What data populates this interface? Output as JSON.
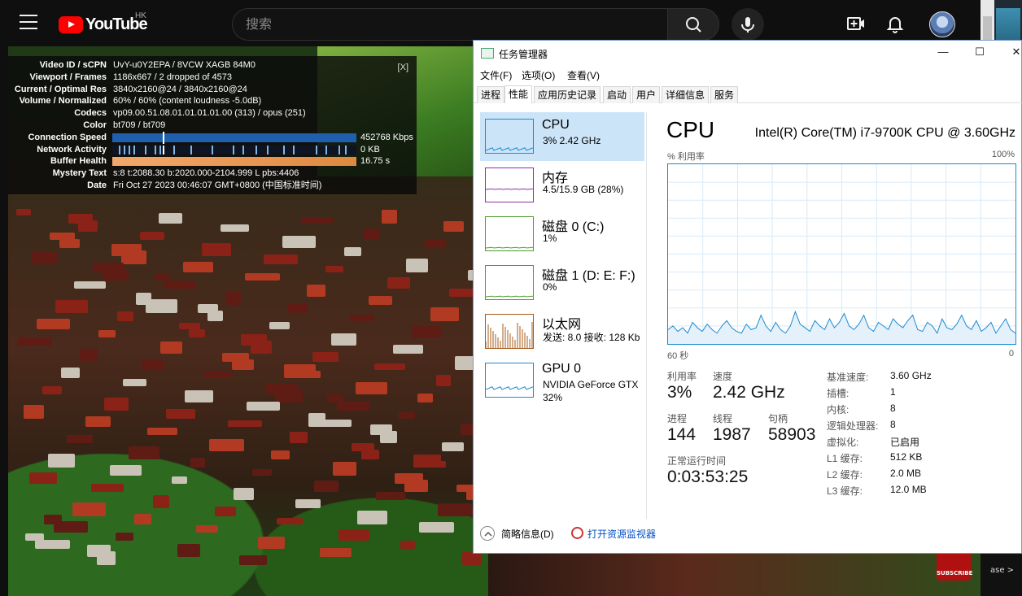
{
  "youtube": {
    "logo_text": "YouTube",
    "region": "HK",
    "search_placeholder": "搜索"
  },
  "stats": {
    "close_label": "[X]",
    "rows": [
      {
        "k": "Video ID / sCPN",
        "v": "UvY-u0Y2EPA  /  8VCW XAGB 84M0"
      },
      {
        "k": "Viewport / Frames",
        "v": "1186x667 / 2 dropped of 4573"
      },
      {
        "k": "Current / Optimal Res",
        "v": "3840x2160@24 / 3840x2160@24"
      },
      {
        "k": "Volume / Normalized",
        "v": "60% / 60% (content loudness -5.0dB)"
      },
      {
        "k": "Codecs",
        "v": "vp09.00.51.08.01.01.01.01.00 (313) / opus (251)"
      },
      {
        "k": "Color",
        "v": "bt709 / bt709"
      },
      {
        "k": "Connection Speed",
        "v": "452768 Kbps"
      },
      {
        "k": "Network Activity",
        "v": "0 KB"
      },
      {
        "k": "Buffer Health",
        "v": "16.75 s"
      },
      {
        "k": "Mystery Text",
        "v": "s:8 t:2088.30 b:2020.000-2104.999 L pbs:4406"
      },
      {
        "k": "Date",
        "v": "Fri Oct 27 2023 00:46:07 GMT+0800 (中国标准时间)"
      }
    ]
  },
  "taskmgr": {
    "title": "任务管理器",
    "window_controls": [
      "—",
      "☐",
      "✕"
    ],
    "menu": [
      "文件(F)",
      "选项(O)",
      "查看(V)"
    ],
    "tabs": [
      "进程",
      "性能",
      "应用历史记录",
      "启动",
      "用户",
      "详细信息",
      "服务"
    ],
    "active_tab": "性能",
    "sidebar": [
      {
        "name": "CPU",
        "sub": "3% 2.42 GHz",
        "sub2": "",
        "color": "#1b8bd0"
      },
      {
        "name": "内存",
        "sub": "4.5/15.9 GB (28%)",
        "sub2": "",
        "color": "#8b2fa8"
      },
      {
        "name": "磁盘 0 (C:)",
        "sub": "1%",
        "sub2": "",
        "color": "#4aa02c"
      },
      {
        "name": "磁盘 1 (D: E: F:)",
        "sub": "0%",
        "sub2": "",
        "color": "#4aa02c"
      },
      {
        "name": "以太网",
        "sub": "发送: 8.0  接收: 128 Kb",
        "sub2": "",
        "color": "#a7591a"
      },
      {
        "name": "GPU 0",
        "sub": "NVIDIA GeForce GTX",
        "sub2": "32%",
        "color": "#1b8bd0"
      }
    ],
    "detail": {
      "title": "CPU",
      "model": "Intel(R) Core(TM) i7-9700K CPU @ 3.60GHz",
      "util_label": "% 利用率",
      "util_max": "100%",
      "axis_left": "60 秒",
      "axis_right": "0",
      "stats": {
        "util_label": "利用率",
        "util_value": "3%",
        "speed_label": "速度",
        "speed_value": "2.42 GHz",
        "proc_label": "进程",
        "proc_value": "144",
        "thread_label": "线程",
        "thread_value": "1987",
        "handle_label": "句柄",
        "handle_value": "58903",
        "uptime_label": "正常运行时间",
        "uptime_value": "0:03:53:25"
      },
      "specs": [
        {
          "k": "基准速度:",
          "v": "3.60 GHz"
        },
        {
          "k": "插槽:",
          "v": "1"
        },
        {
          "k": "内核:",
          "v": "8"
        },
        {
          "k": "逻辑处理器:",
          "v": "8"
        },
        {
          "k": "虚拟化:",
          "v": "已启用"
        },
        {
          "k": "L1 缓存:",
          "v": "512 KB"
        },
        {
          "k": "L2 缓存:",
          "v": "2.0 MB"
        },
        {
          "k": "L3 缓存:",
          "v": "12.0 MB"
        }
      ]
    },
    "footer": {
      "summary": "简略信息(D)",
      "resmon": "打开资源监视器"
    },
    "cpu_history": [
      8,
      10,
      7,
      9,
      6,
      12,
      9,
      7,
      11,
      8,
      6,
      10,
      13,
      9,
      7,
      6,
      11,
      8,
      9,
      16,
      10,
      7,
      12,
      8,
      6,
      10,
      18,
      11,
      9,
      7,
      13,
      10,
      8,
      14,
      9,
      12,
      17,
      10,
      8,
      11,
      16,
      9,
      7,
      12,
      10,
      8,
      14,
      11,
      9,
      13,
      16,
      8,
      7,
      12,
      10,
      6,
      14,
      9,
      8,
      11,
      16,
      10,
      8,
      13,
      7,
      9,
      12,
      6,
      10,
      14,
      8,
      6
    ]
  },
  "page_extra": {
    "subscribe": "SUBSCRIBE",
    "right_text": "ase >"
  }
}
